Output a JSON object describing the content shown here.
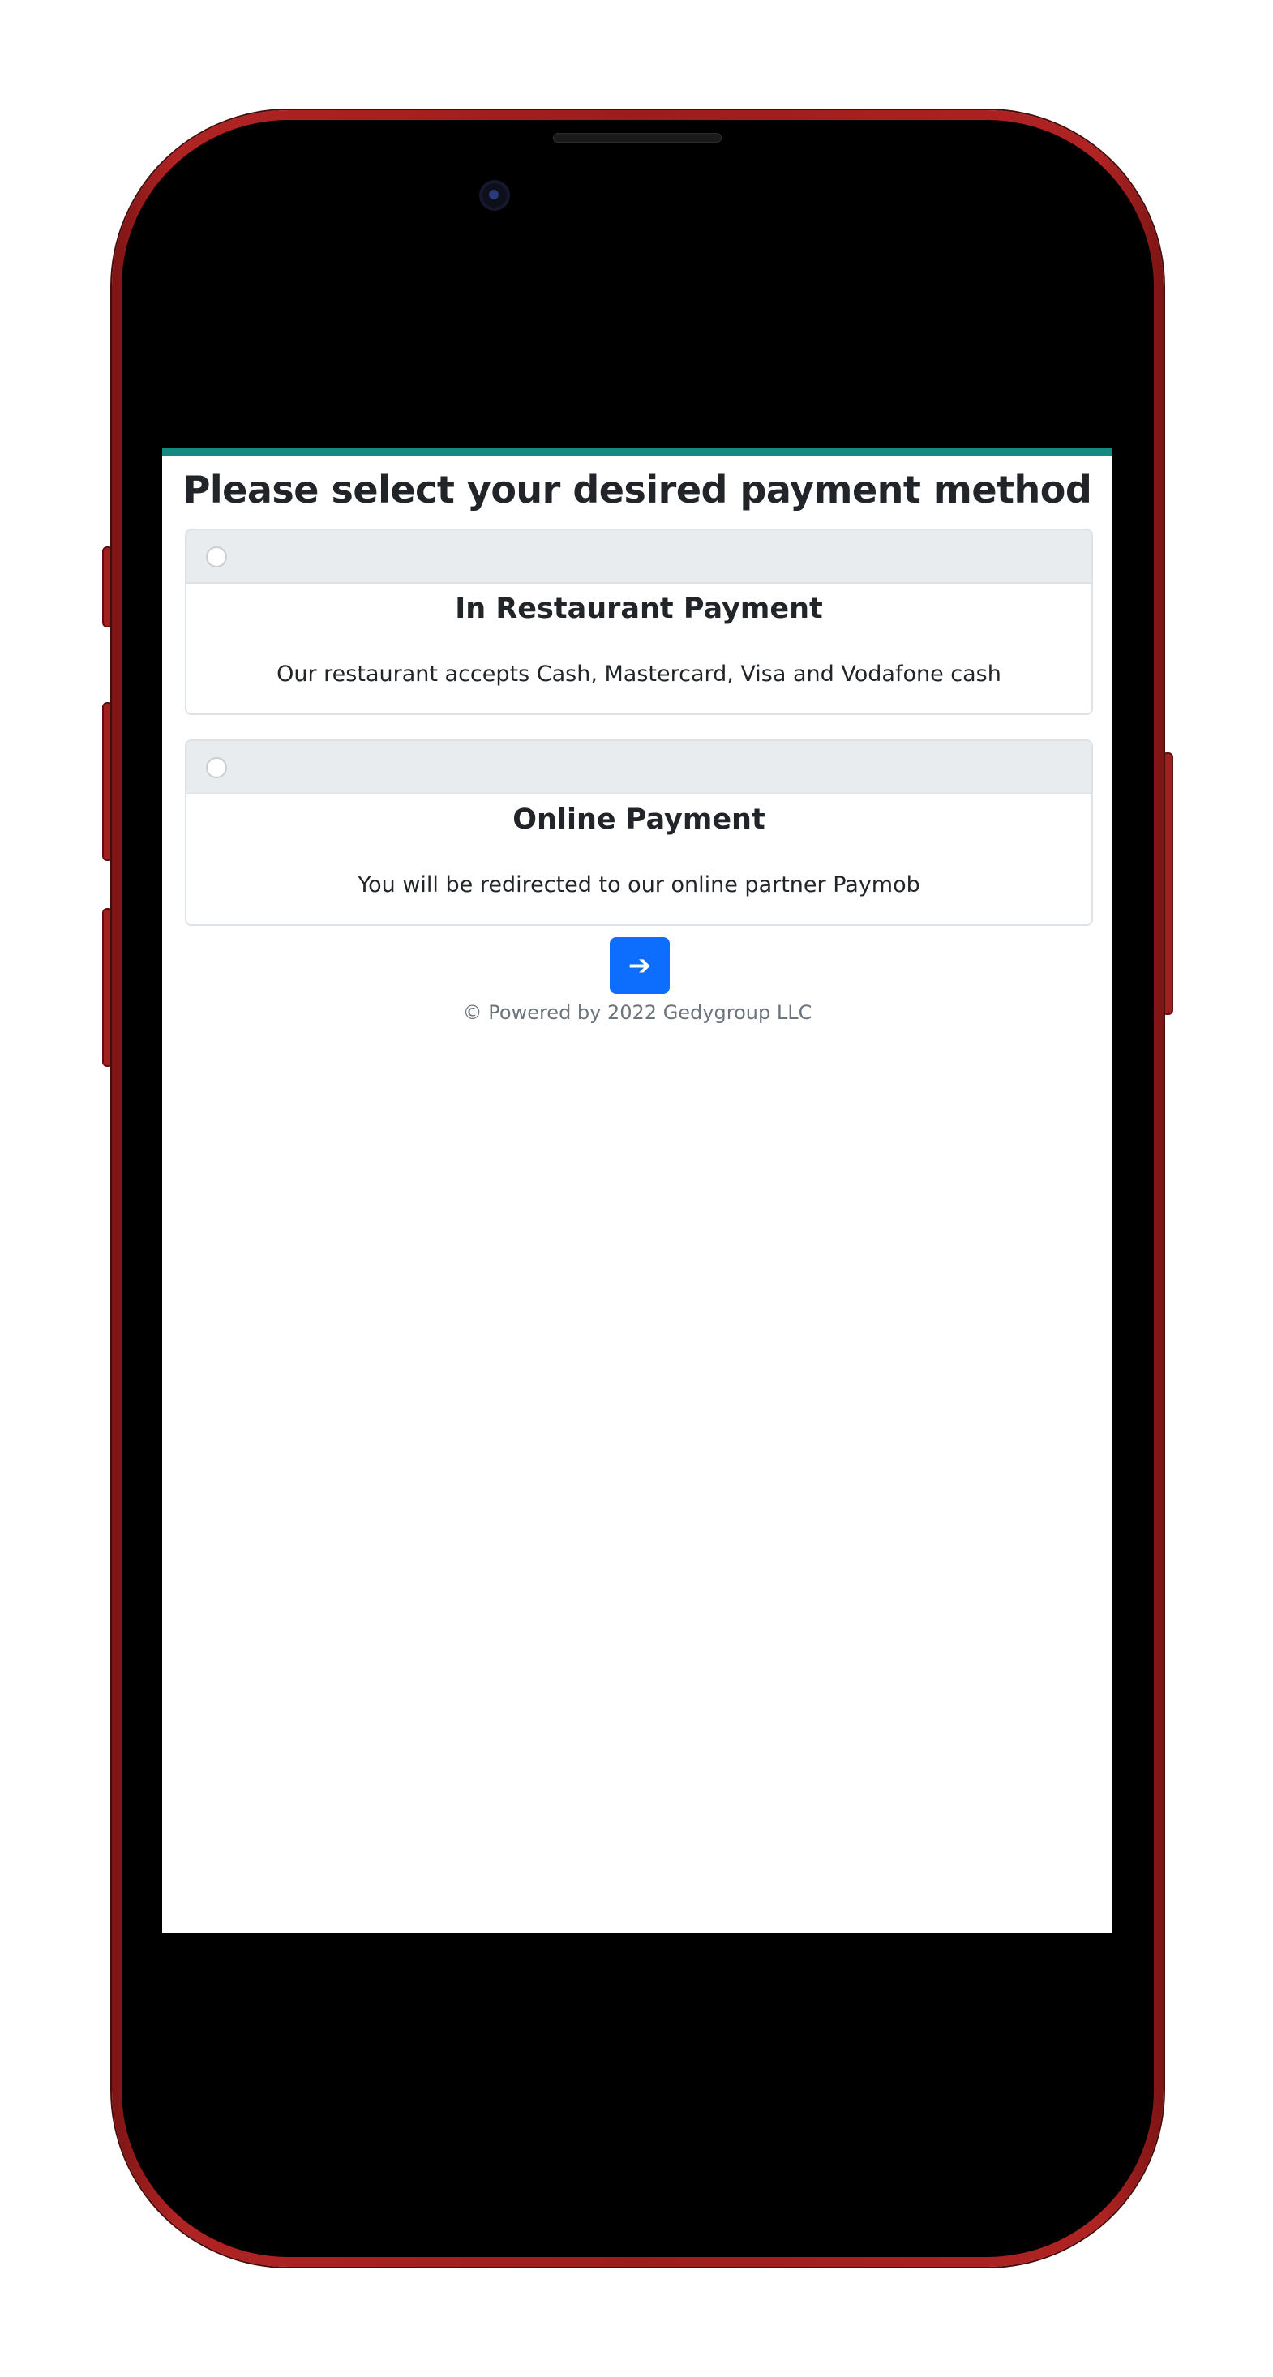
{
  "page": {
    "title": "Please select your desired payment method"
  },
  "payment_options": [
    {
      "title": "In Restaurant Payment",
      "description": "Our restaurant accepts Cash, Mastercard, Visa and Vodafone cash",
      "selected": false
    },
    {
      "title": "Online Payment",
      "description": "You will be redirected to our online partner Paymob",
      "selected": false
    }
  ],
  "actions": {
    "next_label": "➔",
    "next_icon": "arrow-right-icon"
  },
  "footer": {
    "text": "© Powered by 2022 Gedygroup LLC"
  },
  "colors": {
    "accent_bar": "#138a80",
    "primary_button": "#0d6efd",
    "card_header": "#e9ecef",
    "phone_body": "#9c1c1c"
  }
}
